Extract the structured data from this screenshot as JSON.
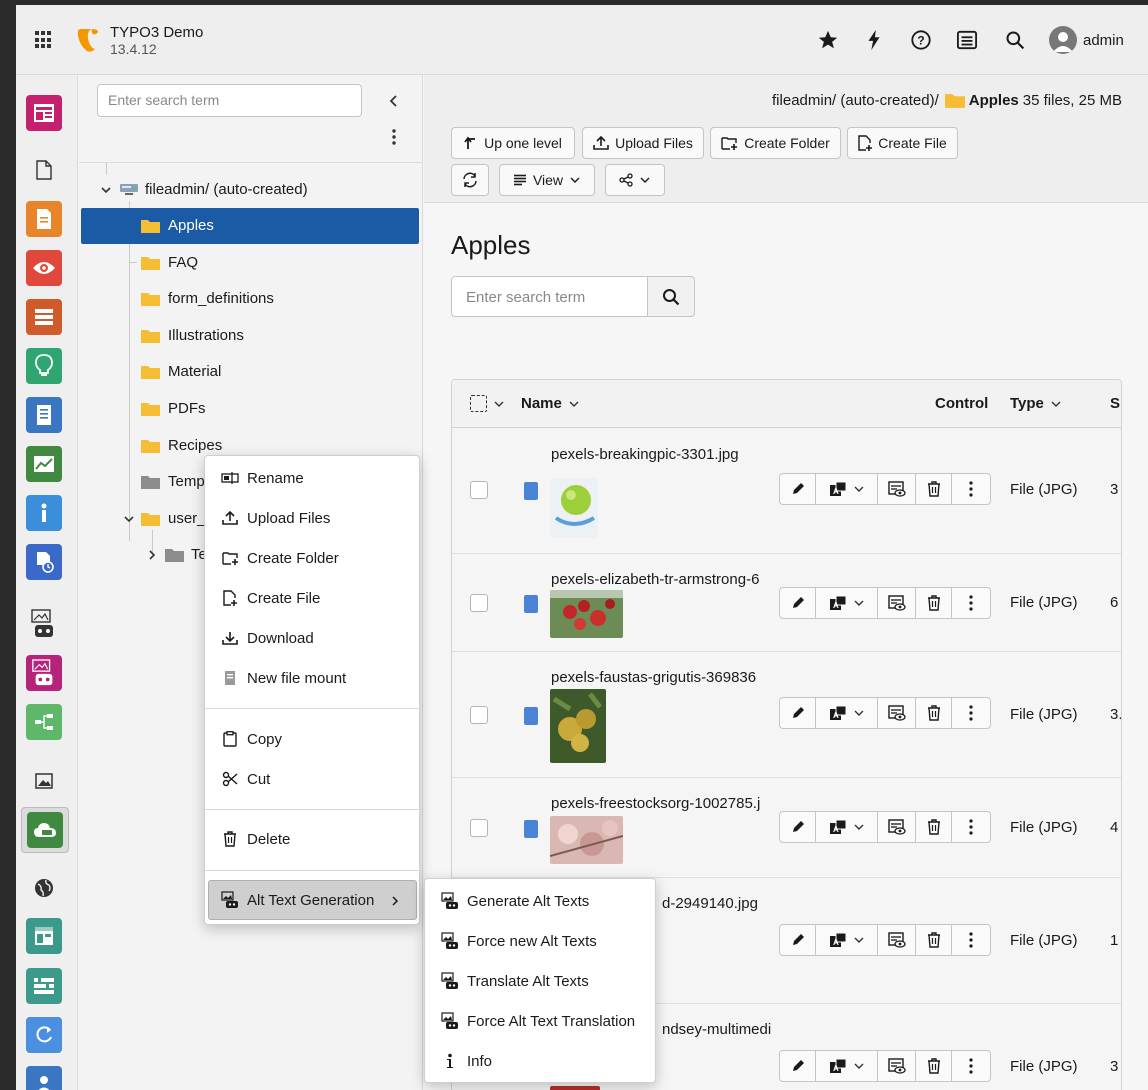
{
  "topbar": {
    "site_name": "TYPO3 Demo",
    "site_version": "13.4.12",
    "username": "admin",
    "logo_color": "#f49700"
  },
  "modules": [
    {
      "name": "page-module",
      "color": "#c4206d"
    },
    {
      "name": "list-module",
      "color": "transparent"
    },
    {
      "name": "file-module",
      "color": "#e8842a"
    },
    {
      "name": "view-module",
      "color": "#e0483b"
    },
    {
      "name": "content-module",
      "color": "#d15a2a"
    },
    {
      "name": "info-module",
      "color": "#2fa572"
    },
    {
      "name": "report-module",
      "color": "#3a76c2"
    },
    {
      "name": "stats-module",
      "color": "#3f8a40"
    },
    {
      "name": "i-module",
      "color": "#3b8ed9"
    },
    {
      "name": "history-module",
      "color": "#3a69c9"
    }
  ],
  "tree": {
    "search_placeholder": "Enter search term",
    "root_label": "fileadmin/ (auto-created)",
    "items": [
      {
        "label": "Apples"
      },
      {
        "label": "FAQ"
      },
      {
        "label": "form_definitions"
      },
      {
        "label": "Illustrations"
      },
      {
        "label": "Material"
      },
      {
        "label": "PDFs"
      },
      {
        "label": "Recipes"
      },
      {
        "label": "Temp"
      },
      {
        "label": "user_"
      },
      {
        "label": "Te"
      }
    ]
  },
  "header": {
    "path_prefix": "fileadmin/ (auto-created)/",
    "current_folder": "Apples",
    "folder_stats": "35 files, 25 MB",
    "buttons": {
      "up": "Up one level",
      "upload": "Upload Files",
      "create_folder": "Create Folder",
      "create_file": "Create File",
      "view": "View"
    }
  },
  "main": {
    "title": "Apples",
    "search_placeholder": "Enter search term",
    "columns": {
      "name": "Name",
      "control": "Control",
      "type": "Type",
      "size": "S"
    }
  },
  "files": [
    {
      "name": "pexels-breakingpic-3301.jpg",
      "type": "File (JPG)",
      "size": "3"
    },
    {
      "name": "pexels-elizabeth-tr-armstrong-6",
      "type": "File (JPG)",
      "size": "6"
    },
    {
      "name": "pexels-faustas-grigutis-369836",
      "type": "File (JPG)",
      "size": "3."
    },
    {
      "name": "pexels-freestocksorg-1002785.j",
      "type": "File (JPG)",
      "size": "4"
    },
    {
      "name": "d-2949140.jpg",
      "type": "File (JPG)",
      "size": "1"
    },
    {
      "name": "ndsey-multimedi",
      "type": "File (JPG)",
      "size": "3"
    }
  ],
  "context_menu": {
    "rename": "Rename",
    "upload": "Upload Files",
    "create_folder": "Create Folder",
    "create_file": "Create File",
    "download": "Download",
    "new_mount": "New file mount",
    "copy": "Copy",
    "cut": "Cut",
    "delete": "Delete",
    "alt_text": "Alt Text Generation"
  },
  "submenu": {
    "generate": "Generate Alt Texts",
    "force_new": "Force new Alt Texts",
    "translate": "Translate Alt Texts",
    "force_translate": "Force Alt Text Translation",
    "info": "Info"
  }
}
